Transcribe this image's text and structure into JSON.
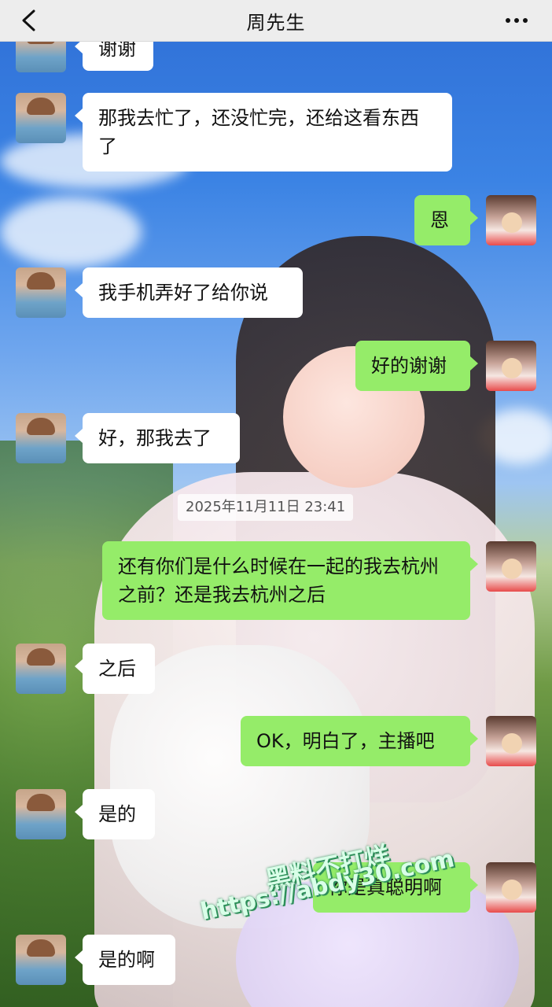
{
  "header": {
    "title": "周先生"
  },
  "messages": [
    {
      "side": "in",
      "text": "谢谢"
    },
    {
      "side": "in",
      "text": "那我去忙了，还没忙完，还给这看东西了"
    },
    {
      "side": "out",
      "text": "恩"
    },
    {
      "side": "in",
      "text": "我手机弄好了给你说"
    },
    {
      "side": "out",
      "text": "好的谢谢"
    },
    {
      "side": "in",
      "text": "好，那我去了"
    },
    {
      "side": "out",
      "text": "还有你们是什么时候在一起的我去杭州之前？还是我去杭州之后"
    },
    {
      "side": "in",
      "text": "之后"
    },
    {
      "side": "out",
      "text": "OK，明白了，主播吧"
    },
    {
      "side": "in",
      "text": "是的"
    },
    {
      "side": "out",
      "text": "你是真聪明啊"
    },
    {
      "side": "in",
      "text": "是的啊"
    }
  ],
  "timestamp": "2025年11月11日 23:41",
  "watermark": {
    "line1": "黑料不打烊",
    "line2": "https://abdy30.com"
  }
}
